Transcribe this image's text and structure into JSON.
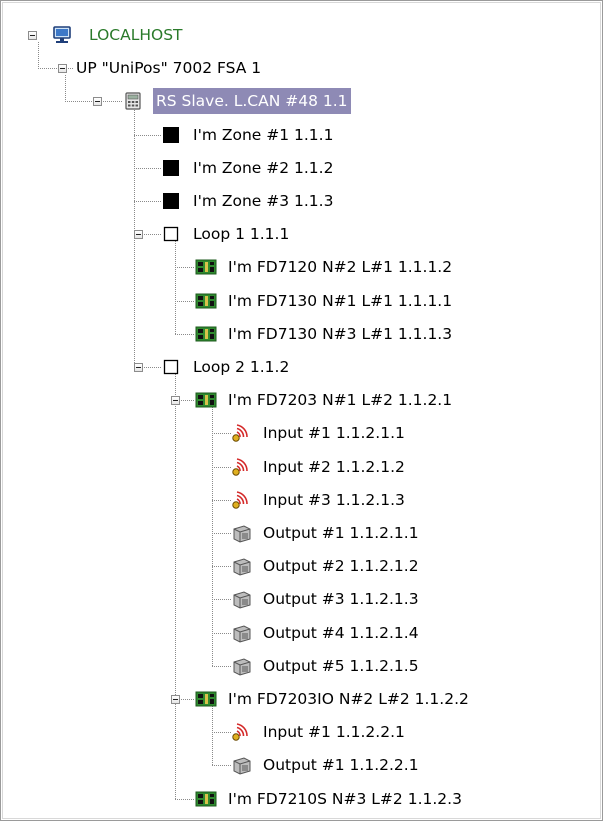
{
  "tree": {
    "nodes": [
      {
        "label": "LOCALHOST",
        "icon": "computer-icon",
        "depth": 0,
        "expanded": true
      },
      {
        "label": "UP \"UniPos\" 7002 FSA 1",
        "icon": "",
        "depth": 1,
        "expanded": true
      },
      {
        "label": "RS Slave. L.CAN #48 1.1",
        "icon": "calculator-icon",
        "depth": 2,
        "expanded": true,
        "selected": true
      },
      {
        "label": "I'm Zone #1 1.1.1",
        "icon": "zone-filled-square-icon",
        "depth": 3
      },
      {
        "label": "I'm Zone #2 1.1.2",
        "icon": "zone-filled-square-icon",
        "depth": 3
      },
      {
        "label": "I'm Zone #3 1.1.3",
        "icon": "zone-filled-square-icon",
        "depth": 3
      },
      {
        "label": "Loop 1 1.1.1",
        "icon": "loop-empty-square-icon",
        "depth": 3,
        "expanded": true
      },
      {
        "label": "I'm FD7120 N#2 L#1 1.1.1.2",
        "icon": "circuit-board-icon",
        "depth": 4
      },
      {
        "label": "I'm FD7130 N#1 L#1 1.1.1.1",
        "icon": "circuit-board-icon",
        "depth": 4
      },
      {
        "label": "I'm FD7130 N#3 L#1  1.1.1.3",
        "icon": "circuit-board-icon",
        "depth": 4
      },
      {
        "label": "Loop 2 1.1.2",
        "icon": "loop-empty-square-icon",
        "depth": 3,
        "expanded": true
      },
      {
        "label": "I'm FD7203 N#1 L#2 1.1.2.1",
        "icon": "circuit-board-icon",
        "depth": 4,
        "expanded": true
      },
      {
        "label": "Input #1 1.1.2.1.1",
        "icon": "signal-input-icon",
        "depth": 5
      },
      {
        "label": "Input #2 1.1.2.1.2",
        "icon": "signal-input-icon",
        "depth": 5
      },
      {
        "label": "Input #3 1.1.2.1.3",
        "icon": "signal-input-icon",
        "depth": 5
      },
      {
        "label": "Output #1 1.1.2.1.1",
        "icon": "output-relay-icon",
        "depth": 5
      },
      {
        "label": "Output #2 1.1.2.1.2",
        "icon": "output-relay-icon",
        "depth": 5
      },
      {
        "label": "Output #3 1.1.2.1.3",
        "icon": "output-relay-icon",
        "depth": 5
      },
      {
        "label": "Output #4 1.1.2.1.4",
        "icon": "output-relay-icon",
        "depth": 5
      },
      {
        "label": "Output #5 1.1.2.1.5",
        "icon": "output-relay-icon",
        "depth": 5
      },
      {
        "label": "I'm FD7203IO N#2 L#2 1.1.2.2",
        "icon": "circuit-board-icon",
        "depth": 4,
        "expanded": true
      },
      {
        "label": "Input #1 1.1.2.2.1",
        "icon": "signal-input-icon",
        "depth": 5
      },
      {
        "label": "Output #1 1.1.2.2.1",
        "icon": "output-relay-icon",
        "depth": 5
      },
      {
        "label": "I'm FD7210S N#3 L#2 1.1.2.3",
        "icon": "circuit-board-icon",
        "depth": 4
      }
    ]
  },
  "colors": {
    "selection": "#8e8ab5",
    "host_text": "#2a7a2a",
    "input_icon": "#d42a2a",
    "board_icon": "#2f8a2f"
  }
}
